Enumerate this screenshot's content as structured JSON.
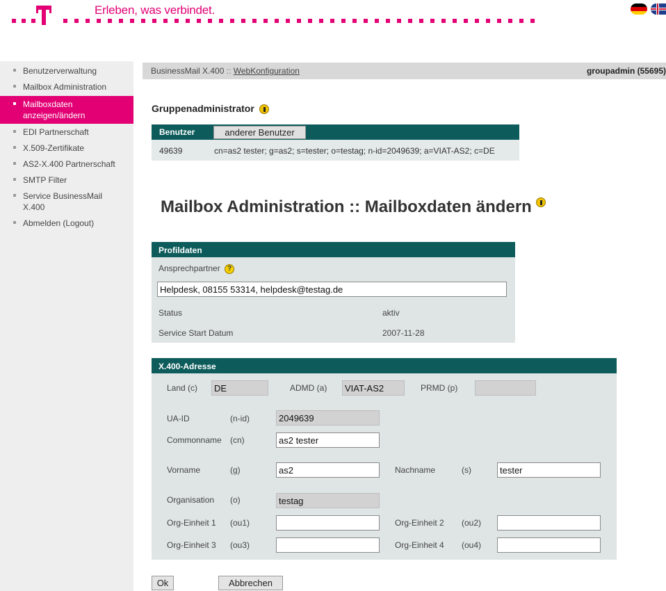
{
  "header": {
    "slogan": "Erleben, was verbindet.",
    "brand_color": "#e20074",
    "flags": [
      "de-flag-icon",
      "uk-flag-icon"
    ]
  },
  "sidebar": {
    "items": [
      {
        "label": "Benutzerverwaltung",
        "active": false
      },
      {
        "label": "Mailbox Administration",
        "active": false
      },
      {
        "label": "Mailboxdaten anzeigen/ändern",
        "active": true
      },
      {
        "label": "EDI Partnerschaft",
        "active": false
      },
      {
        "label": "X.509-Zertifikate",
        "active": false
      },
      {
        "label": "AS2-X.400 Partnerschaft",
        "active": false
      },
      {
        "label": "SMTP Filter",
        "active": false
      },
      {
        "label": "Service BusinessMail X.400",
        "active": false
      },
      {
        "label": "Abmelden (Logout)",
        "active": false
      }
    ]
  },
  "topbar": {
    "product": "BusinessMail X.400",
    "separator": "::",
    "link": "WebKonfiguration",
    "user": "groupadmin (55695)"
  },
  "group": {
    "title": "Gruppenadministrator",
    "tab_active": "Benutzer",
    "tab_other": "anderer Benutzer",
    "user_id": "49639",
    "user_dn": "cn=as2 tester; g=as2; s=tester; o=testag; n-id=2049639; a=VIAT-AS2; c=DE"
  },
  "main": {
    "title": "Mailbox Administration :: Mailboxdaten ändern"
  },
  "profil": {
    "header": "Profildaten",
    "contact_label": "Ansprechpartner",
    "contact_value": "Helpdesk, 08155 53314, helpdesk@testag.de",
    "status_label": "Status",
    "status_value": "aktiv",
    "start_label": "Service Start Datum",
    "start_value": "2007-11-28"
  },
  "x400": {
    "header": "X.400-Adresse",
    "land_label": "Land (c)",
    "land_value": "DE",
    "admd_label": "ADMD (a)",
    "admd_value": "VIAT-AS2",
    "prmd_label": "PRMD (p)",
    "prmd_value": "",
    "uaid_label": "UA-ID",
    "uaid_key": "(n-id)",
    "uaid_value": "2049639",
    "cn_label": "Commonname",
    "cn_key": "(cn)",
    "cn_value": "as2 tester",
    "g_label": "Vorname",
    "g_key": "(g)",
    "g_value": "as2",
    "s_label": "Nachname",
    "s_key": "(s)",
    "s_value": "tester",
    "o_label": "Organisation",
    "o_key": "(o)",
    "o_value": "testag",
    "ou1_label": "Org-Einheit 1",
    "ou1_key": "(ou1)",
    "ou1_value": "",
    "ou2_label": "Org-Einheit 2",
    "ou2_key": "(ou2)",
    "ou2_value": "",
    "ou3_label": "Org-Einheit 3",
    "ou3_key": "(ou3)",
    "ou3_value": "",
    "ou4_label": "Org-Einheit 4",
    "ou4_key": "(ou4)",
    "ou4_value": ""
  },
  "actions": {
    "ok": "Ok",
    "cancel": "Abbrechen"
  }
}
